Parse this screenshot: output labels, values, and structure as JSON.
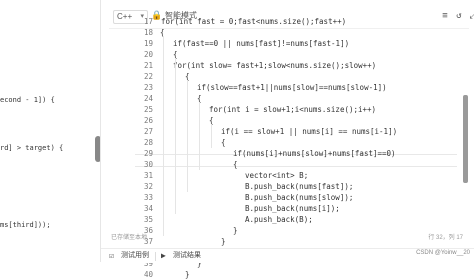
{
  "left_panel": {
    "lines": [
      {
        "text": "econd - 1]) {"
      },
      {
        "text": "rd] > target) {"
      },
      {
        "text": "ms[third]));"
      }
    ]
  },
  "editor": {
    "language": "C++",
    "smart_mode_label": "智能模式",
    "line_numbers": [
      "17",
      "18",
      "19",
      "20",
      "21",
      "22",
      "23",
      "24",
      "25",
      "26",
      "27",
      "28",
      "29",
      "30",
      "31",
      "32",
      "33",
      "34",
      "35",
      "36",
      "37",
      "38",
      "39",
      "40"
    ],
    "code_lines": [
      "for(int fast = 0;fast<nums.size();fast++)",
      "{",
      "if(fast==0 || nums[fast]!=nums[fast-1])",
      "{",
      "for(int slow= fast+1;slow<nums.size();slow++)",
      "{",
      "if(slow==fast+1||nums[slow]==nums[slow-1])",
      "{",
      "for(int i = slow+1;i<nums.size();i++)",
      "{",
      "if(i == slow+1 || nums[i] == nums[i-1])",
      "{",
      "if(nums[i]+nums[slow]+nums[fast]==0)",
      "{",
      "vector<int> B;",
      "B.push_back(nums[fast]);",
      "B.push_back(nums[slow]);",
      "B.push_back(nums[i]);",
      "A.push_back(B);",
      "}",
      "}",
      "}",
      "}",
      "}"
    ],
    "status_left": "已存储至本地",
    "status_right": "行 32，列 17"
  },
  "bottom": {
    "test_case_label": "测试用例",
    "test_result_label": "测试结果",
    "watermark": "CSDN @Yoinw__20"
  }
}
